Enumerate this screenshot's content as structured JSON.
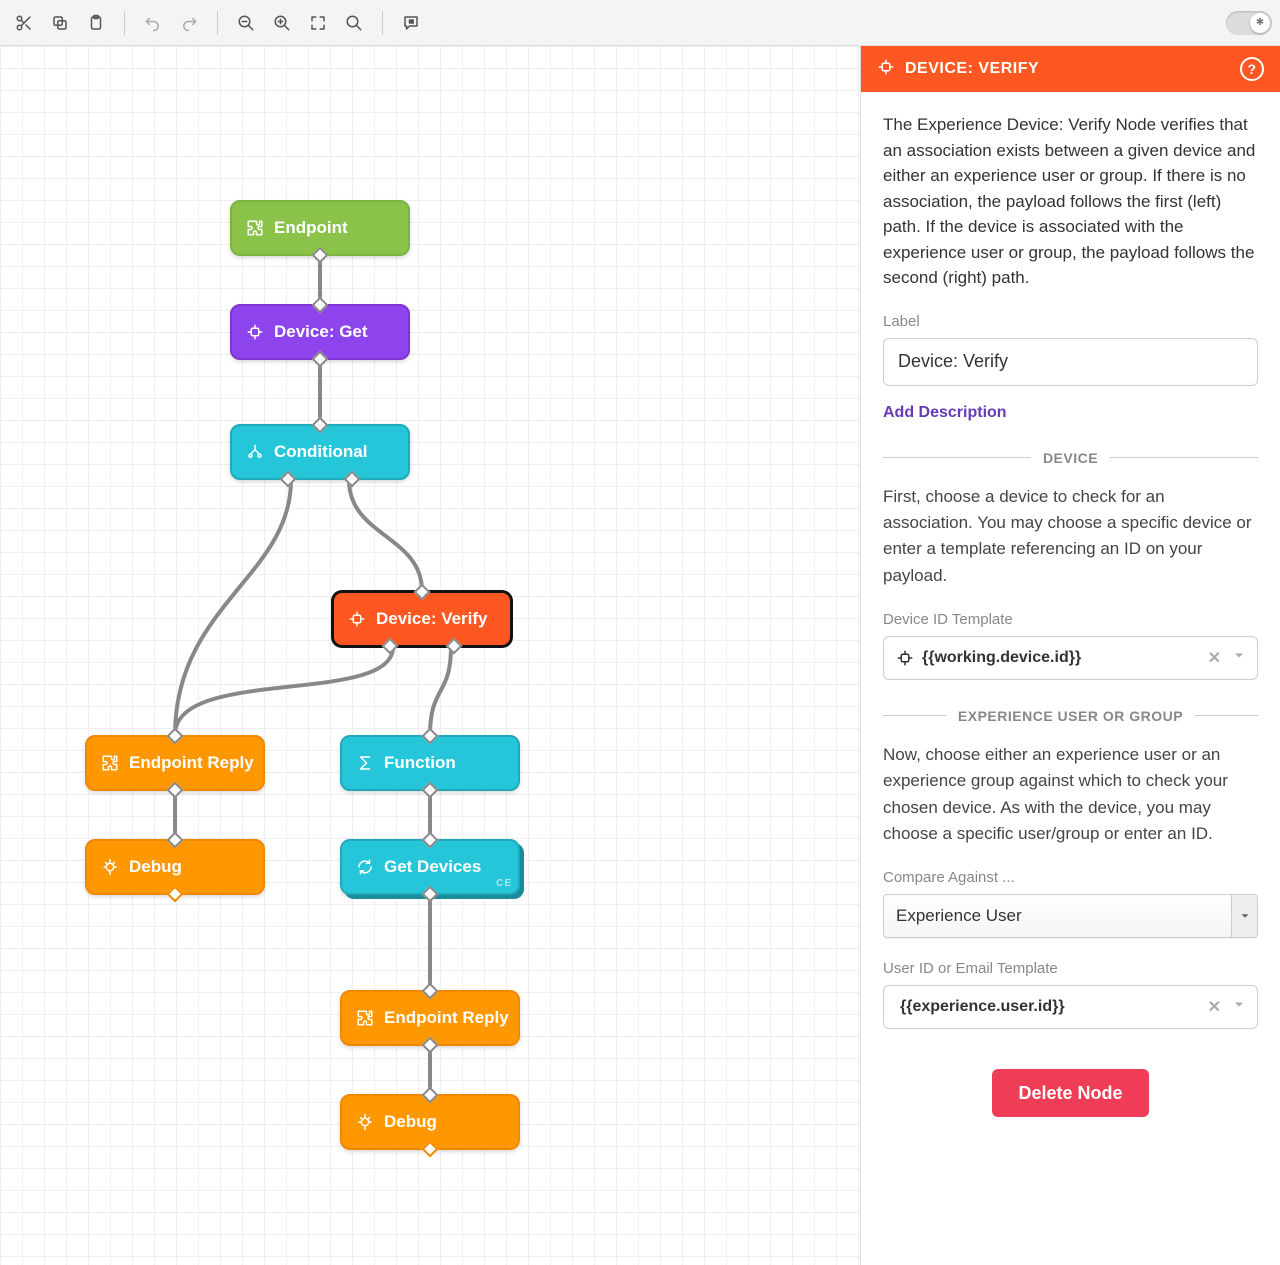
{
  "panel": {
    "title": "DEVICE: VERIFY",
    "description": "The Experience Device: Verify Node verifies that an association exists between a given device and either an experience user or group. If there is no association, the payload follows the first (left) path. If the device is associated with the experience user or group, the payload follows the second (right) path.",
    "label_field_label": "Label",
    "label_value": "Device: Verify",
    "add_description": "Add Description",
    "section_device_title": "DEVICE",
    "device_help": "First, choose a device to check for an association. You may choose a specific device or enter a template referencing an ID on your payload.",
    "device_id_label": "Device ID Template",
    "device_id_value": "{{working.device.id}}",
    "section_compare_title": "EXPERIENCE USER OR GROUP",
    "compare_help": "Now, choose either an experience user or an experience group against which to check your chosen device. As with the device, you may choose a specific user/group or enter an ID.",
    "compare_against_label": "Compare Against ...",
    "compare_against_value": "Experience User",
    "user_id_label": "User ID or Email Template",
    "user_id_value": "{{experience.user.id}}",
    "delete_label": "Delete Node"
  },
  "nodes": {
    "endpoint": "Endpoint",
    "device_get": "Device: Get",
    "conditional": "Conditional",
    "device_verify": "Device: Verify",
    "endpoint_reply": "Endpoint Reply",
    "debug": "Debug",
    "function": "Function",
    "get_devices": "Get Devices",
    "endpoint_reply2": "Endpoint Reply",
    "debug2": "Debug"
  }
}
